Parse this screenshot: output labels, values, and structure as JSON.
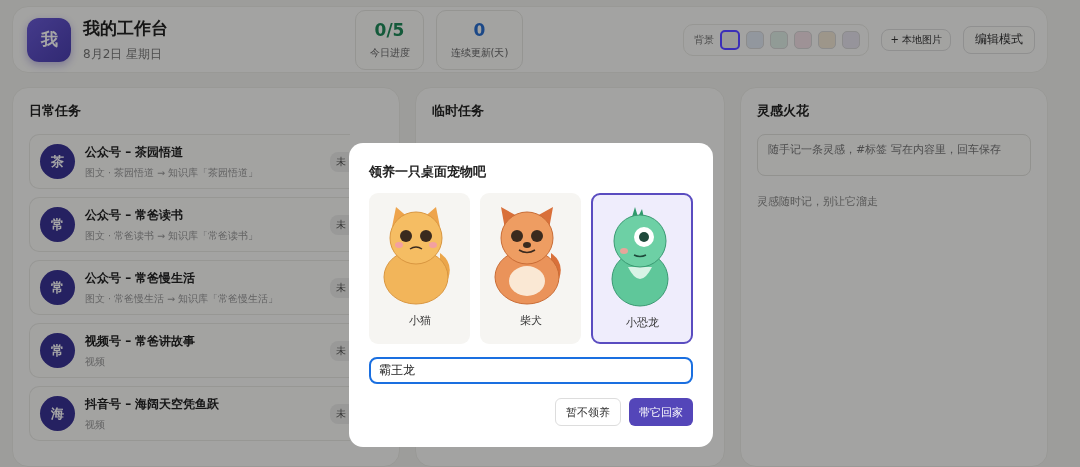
{
  "header": {
    "avatar": "我",
    "title": "我的工作台",
    "date": "8月2日  星期日",
    "stats": [
      {
        "kind": "progress",
        "value": "0/5",
        "label": "今日进度"
      },
      {
        "kind": "streak",
        "value": "0",
        "label": "连续更新(天)"
      }
    ],
    "background": {
      "label": "背景",
      "swatches": [
        {
          "color": "#9b9b98",
          "selected": true
        },
        {
          "color": "#92979e",
          "selected": false
        },
        {
          "color": "#919b96",
          "selected": false
        },
        {
          "color": "#9e9296",
          "selected": false
        },
        {
          "color": "#9d968a",
          "selected": false
        },
        {
          "color": "#96949b",
          "selected": false
        }
      ]
    },
    "local_image_button": "+ 本地图片",
    "edit_button": "编辑模式"
  },
  "daily_tasks": {
    "title": "日常任务",
    "items": [
      {
        "avatar": "茶",
        "title": "公众号 – 茶园悟道",
        "subtitle": "图文 · 茶园悟道 → 知识库「茶园悟道」",
        "status": "未"
      },
      {
        "avatar": "常",
        "title": "公众号 – 常爸读书",
        "subtitle": "图文 · 常爸读书 → 知识库「常爸读书」",
        "status": "未"
      },
      {
        "avatar": "常",
        "title": "公众号 – 常爸慢生活",
        "subtitle": "图文 · 常爸慢生活 → 知识库「常爸慢生活」",
        "status": "未"
      },
      {
        "avatar": "常",
        "title": "视频号 – 常爸讲故事",
        "subtitle": "视频",
        "status": "未"
      },
      {
        "avatar": "海",
        "title": "抖音号 – 海阔天空凭鱼跃",
        "subtitle": "视频",
        "status": "未"
      }
    ]
  },
  "temp_tasks": {
    "title": "临时任务"
  },
  "ideas": {
    "title": "灵感火花",
    "placeholder": "随手记一条灵感，#标签 写在内容里，回车保存",
    "hint": "灵感随时记，别让它溜走"
  },
  "dialog": {
    "title": "领养一只桌面宠物吧",
    "pets": [
      {
        "kind": "cat",
        "name": "小猫",
        "selected": false
      },
      {
        "kind": "dog",
        "name": "柴犬",
        "selected": false
      },
      {
        "kind": "dino",
        "name": "小恐龙",
        "selected": true
      }
    ],
    "name_value": "霸王龙",
    "buttons": [
      {
        "kind": "secondary",
        "label": "暂不领养"
      },
      {
        "kind": "primary",
        "label": "带它回家"
      }
    ]
  }
}
